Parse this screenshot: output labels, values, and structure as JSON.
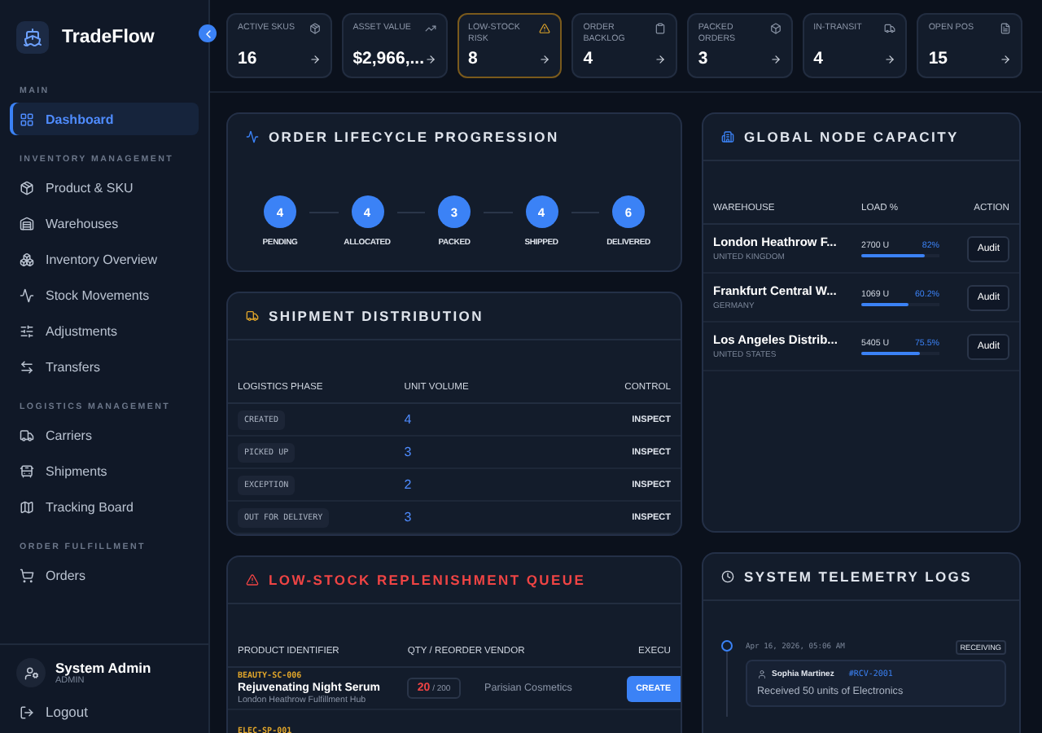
{
  "brand": {
    "name": "TradeFlow"
  },
  "sidebar": {
    "sections": [
      {
        "title": "MAIN",
        "items": [
          {
            "label": "Dashboard",
            "selected": true
          }
        ]
      },
      {
        "title": "INVENTORY MANAGEMENT",
        "items": [
          {
            "label": "Product & SKU",
            "selected": false
          },
          {
            "label": "Warehouses",
            "selected": false
          },
          {
            "label": "Inventory Overview",
            "selected": false
          },
          {
            "label": "Stock Movements",
            "selected": false
          },
          {
            "label": "Adjustments",
            "selected": false
          },
          {
            "label": "Transfers",
            "selected": false
          }
        ]
      },
      {
        "title": "LOGISTICS MANAGEMENT",
        "items": [
          {
            "label": "Carriers",
            "selected": false
          },
          {
            "label": "Shipments",
            "selected": false
          },
          {
            "label": "Tracking Board",
            "selected": false
          }
        ]
      },
      {
        "title": "ORDER FULFILLMENT",
        "items": [
          {
            "label": "Orders",
            "selected": false
          }
        ]
      }
    ],
    "user": {
      "name": "System Admin",
      "role": "ADMIN"
    },
    "logout": "Logout"
  },
  "kpis": [
    {
      "label": "ACTIVE SKUS",
      "value": "16",
      "highlighted": false
    },
    {
      "label": "ASSET VALUE",
      "value": "$2,966,...",
      "highlighted": false
    },
    {
      "label": "LOW-STOCK RISK",
      "value": "8",
      "highlighted": true
    },
    {
      "label": "ORDER BACKLOG",
      "value": "4",
      "highlighted": false
    },
    {
      "label": "PACKED ORDERS",
      "value": "3",
      "highlighted": false
    },
    {
      "label": "IN-TRANSIT",
      "value": "4",
      "highlighted": false
    },
    {
      "label": "OPEN POS",
      "value": "15",
      "highlighted": false
    }
  ],
  "lifecycle": {
    "title": "ORDER LIFECYCLE PROGRESSION",
    "steps": [
      {
        "count": "4",
        "label": "PENDING"
      },
      {
        "count": "4",
        "label": "ALLOCATED"
      },
      {
        "count": "3",
        "label": "PACKED"
      },
      {
        "count": "4",
        "label": "SHIPPED"
      },
      {
        "count": "6",
        "label": "DELIVERED"
      }
    ]
  },
  "shipments": {
    "title": "SHIPMENT DISTRIBUTION",
    "columns": [
      "LOGISTICS PHASE",
      "UNIT VOLUME",
      "CONTROL"
    ],
    "rows": [
      {
        "phase": "CREATED",
        "volume": "4",
        "action": "INSPECT"
      },
      {
        "phase": "PICKED UP",
        "volume": "3",
        "action": "INSPECT"
      },
      {
        "phase": "EXCEPTION",
        "volume": "2",
        "action": "INSPECT"
      },
      {
        "phase": "OUT FOR DELIVERY",
        "volume": "3",
        "action": "INSPECT"
      }
    ]
  },
  "capacity": {
    "title": "GLOBAL NODE CAPACITY",
    "columns": [
      "WAREHOUSE",
      "LOAD %",
      "ACTION"
    ],
    "rows": [
      {
        "name": "London Heathrow F...",
        "country": "UNITED KINGDOM",
        "units": "2700 U",
        "percent": "82%",
        "level": 0.82,
        "action": "Audit"
      },
      {
        "name": "Frankfurt Central W...",
        "country": "GERMANY",
        "units": "1069 U",
        "percent": "60.2%",
        "level": 0.602,
        "action": "Audit"
      },
      {
        "name": "Los Angeles Distrib...",
        "country": "UNITED STATES",
        "units": "5405 U",
        "percent": "75.5%",
        "level": 0.755,
        "action": "Audit"
      }
    ]
  },
  "replenishment": {
    "title": "LOW-STOCK REPLENISHMENT QUEUE",
    "columns": [
      "PRODUCT IDENTIFIER",
      "QTY / REORDER",
      "VENDOR",
      "EXECU"
    ],
    "rows": [
      {
        "sku": "BEAUTY-SC-006",
        "name": "Rejuvenating Night Serum",
        "location": "London Heathrow Fulfillment Hub",
        "qty": "20",
        "separator": "/",
        "reorder": "200",
        "vendor": "Parisian Cosmetics",
        "action": "CREATE"
      },
      {
        "sku": "ELEC-SP-001"
      }
    ]
  },
  "telemetry": {
    "title": "SYSTEM TELEMETRY LOGS",
    "entries": [
      {
        "time": "Apr 16, 2026, 05:06 AM",
        "tag": "RECEIVING",
        "user": "Sophia Martinez",
        "ref": "#RCV-2001",
        "message": "Received 50 units of Electronics"
      }
    ]
  }
}
